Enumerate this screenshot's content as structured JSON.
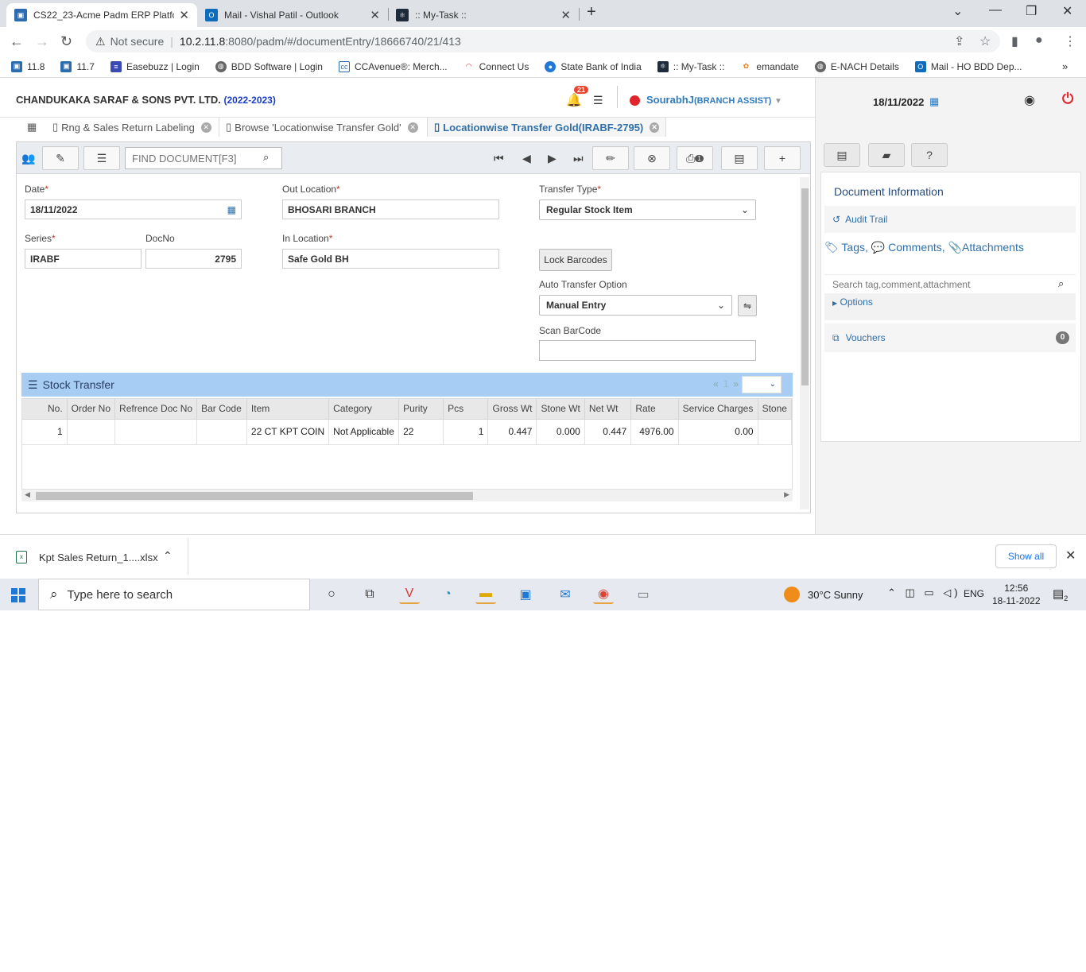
{
  "browser": {
    "tabs": [
      {
        "title": "CS22_23-Acme Padm ERP Platform",
        "icon": "erp-favicon"
      },
      {
        "title": "Mail - Vishal Patil - Outlook",
        "icon": "outlook-favicon"
      },
      {
        "title": ":: My-Task ::",
        "icon": "react-favicon"
      }
    ],
    "not_secure": "Not secure",
    "url_host": "10.2.11.8",
    "url_path": ":8080/padm/#/documentEntry/18666740/21/413",
    "bookmarks": [
      "11.8",
      "11.7",
      "Easebuzz | Login",
      "BDD Software | Login",
      "CCAvenue®: Merch...",
      "Connect Us",
      "State Bank of India",
      ":: My-Task ::",
      "emandate",
      "E-NACH Details",
      "Mail - HO BDD Dep..."
    ]
  },
  "header": {
    "company": "CHANDUKAKA SARAF & SONS PVT. LTD.",
    "year": "(2022-2023)",
    "notification_count": "21",
    "user": "SourabhJ",
    "role": "(BRANCH ASSIST)"
  },
  "right_panel": {
    "date": "18/11/2022",
    "doc_info_title": "Document Information",
    "audit_trail": "Audit Trail",
    "tags": "Tags,",
    "comments": "Comments,",
    "attachments": "Attachments",
    "search_placeholder": "Search tag,comment,attachment",
    "options": "Options",
    "vouchers": "Vouchers",
    "vouchers_count": "0"
  },
  "doc_tabs": [
    "Rng & Sales Return Labeling",
    "Browse 'Locationwise Transfer Gold'",
    "Locationwise Transfer Gold(IRABF-2795)"
  ],
  "toolbar": {
    "find_placeholder": "FIND DOCUMENT[F3]",
    "print_badge": "1"
  },
  "form": {
    "date_label": "Date",
    "date_value": "18/11/2022",
    "series_label": "Series",
    "series_value": "IRABF",
    "docno_label": "DocNo",
    "docno_value": "2795",
    "out_location_label": "Out Location",
    "out_location_value": "BHOSARI BRANCH",
    "in_location_label": "In Location",
    "in_location_value": "Safe Gold BH",
    "transfer_type_label": "Transfer Type",
    "transfer_type_value": "Regular Stock Item",
    "lock_barcodes": "Lock Barcodes",
    "auto_transfer_label": "Auto Transfer Option",
    "auto_transfer_value": "Manual Entry",
    "scan_barcode_label": "Scan BarCode"
  },
  "grid": {
    "title": "Stock Transfer",
    "page": "1",
    "columns": [
      "No.",
      "Order No",
      "Refrence Doc No",
      "Bar Code",
      "Item",
      "Category",
      "Purity",
      "Pcs",
      "Gross Wt",
      "Stone Wt",
      "Net Wt",
      "Rate",
      "Service Charges",
      "Stone"
    ],
    "rows": [
      [
        "1",
        "",
        "",
        "",
        "22 CT KPT COIN",
        "Not Applicable",
        "22",
        "1",
        "0.447",
        "0.000",
        "0.447",
        "4976.00",
        "0.00",
        ""
      ]
    ]
  },
  "downloads": {
    "file": "Kpt Sales Return_1....xlsx",
    "show_all": "Show all"
  },
  "taskbar": {
    "search_placeholder": "Type here to search",
    "weather": "30°C  Sunny",
    "lang": "ENG",
    "time": "12:56",
    "date": "18-11-2022",
    "notif_count": "2"
  }
}
